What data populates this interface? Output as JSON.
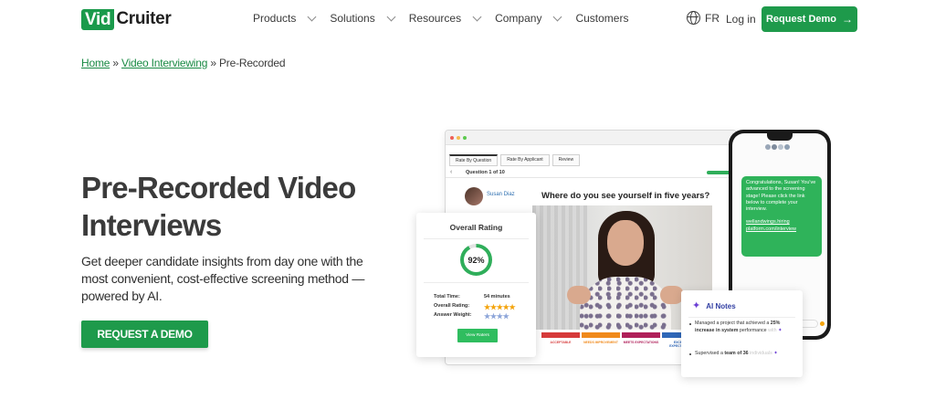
{
  "nav": {
    "logo_box": "Vid",
    "logo_text": "Cruiter",
    "items": [
      {
        "label": "Products",
        "has_dropdown": true
      },
      {
        "label": "Solutions",
        "has_dropdown": true
      },
      {
        "label": "Resources",
        "has_dropdown": true
      },
      {
        "label": "Company",
        "has_dropdown": true
      },
      {
        "label": "Customers",
        "has_dropdown": false
      }
    ],
    "lang": "FR",
    "login": "Log in",
    "cta": "Request Demo",
    "cta_icon": "arrow-right-icon"
  },
  "breadcrumb": {
    "home": "Home",
    "sep": "»",
    "section": "Video Interviewing",
    "current": "Pre-Recorded"
  },
  "hero": {
    "title": "Pre-Recorded Video Interviews",
    "subtitle": "Get deeper candidate insights from day one with the most convenient, cost-effective screening method — powered by AI.",
    "cta": "REQUEST A DEMO"
  },
  "mockup": {
    "tabs": [
      "Rate By Question",
      "Rate By Applicant",
      "Review"
    ],
    "question_counter": "Question 1 of 10",
    "candidate_name": "Susan Diaz",
    "question": "Where do you see yourself in five years?",
    "rating_labels": [
      {
        "label": "ACCEPTABLE",
        "color": "#d63b3b"
      },
      {
        "label": "NEEDS IMPROVEMENT",
        "color": "#f08a1c"
      },
      {
        "label": "MEETS EXPECTATIONS",
        "color": "#b0205a"
      },
      {
        "label": "EXCEEDS EXPECTATIONS",
        "color": "#2f67b8"
      }
    ]
  },
  "rating_card": {
    "title": "Overall Rating",
    "percent": "92%",
    "percent_value": 0.92,
    "total_time_label": "Total Time:",
    "total_time_value": "54 minutes",
    "overall_label": "Overall Rating:",
    "overall_stars": "★★★★★",
    "weight_label": "Answer Weight:",
    "weight_stars": "★★★★",
    "button": "View Raters"
  },
  "phone": {
    "message": "Congratulations, Susan! You've advanced to the screening stage! Please click the link below to complete your interview.",
    "link": "wellandwings.hiring platform.com/interview"
  },
  "ai_notes": {
    "title": "AI Notes",
    "note1_pre": "Managed a project that achieved a ",
    "note1_bold": "25% increase in system",
    "note1_post": " performance",
    "note1_fade": " with",
    "note2_pre": "Supervised a ",
    "note2_bold": "team of 36",
    "note2_fade": "individuals"
  },
  "colors": {
    "brand_green": "#1e9a4b",
    "link_green": "#1a8a44",
    "ai_purple": "#6b3fd4"
  }
}
